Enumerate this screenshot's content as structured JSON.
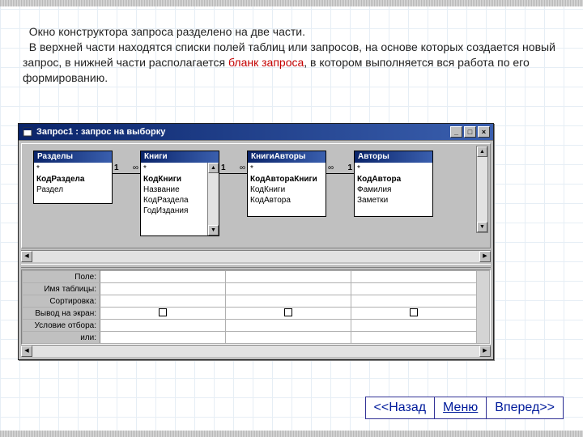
{
  "description": {
    "line1": "Окно конструктора запроса разделено на две части.",
    "line2a": "В верхней части находятся списки полей таблиц или запросов, на основе которых создается новый запрос, в нижней части располагается ",
    "line2_red": "бланк запроса",
    "line2b": ", в котором выполняется вся работа по его формированию."
  },
  "window": {
    "title": "Запрос1 : запрос на выборку"
  },
  "tables": [
    {
      "title": "Разделы",
      "fields": [
        "*",
        "КодРаздела",
        "Раздел"
      ],
      "bold": [
        1
      ]
    },
    {
      "title": "Книги",
      "fields": [
        "*",
        "КодКниги",
        "Название",
        "КодРаздела",
        "ГодИздания"
      ],
      "bold": [
        1
      ]
    },
    {
      "title": "КнигиАвторы",
      "fields": [
        "*",
        "КодАвтораКниги",
        "КодКниги",
        "КодАвтора"
      ],
      "bold": [
        1
      ]
    },
    {
      "title": "Авторы",
      "fields": [
        "*",
        "КодАвтора",
        "Фамилия",
        "Заметки"
      ],
      "bold": [
        1
      ]
    }
  ],
  "relations": {
    "one": "1",
    "many": "∞"
  },
  "grid_rows": [
    "Поле:",
    "Имя таблицы:",
    "Сортировка:",
    "Вывод на экран:",
    "Условие отбора:",
    "или:"
  ],
  "nav": {
    "back": "<<Назад",
    "menu": "Меню",
    "fwd": "Вперед>>"
  }
}
